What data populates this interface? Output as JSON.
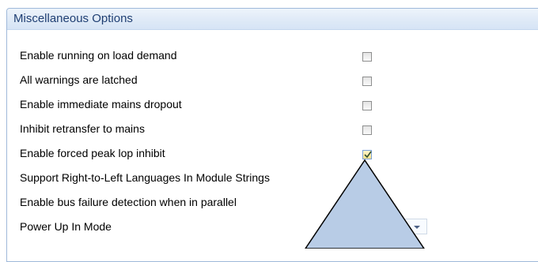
{
  "panel": {
    "title": "Miscellaneous Options"
  },
  "options": [
    {
      "label": "Enable running on load demand",
      "checked": false
    },
    {
      "label": "All warnings are latched",
      "checked": false
    },
    {
      "label": "Enable immediate mains dropout",
      "checked": false
    },
    {
      "label": "Inhibit retransfer to mains",
      "checked": false
    },
    {
      "label": "Enable forced peak lop inhibit",
      "checked": true
    },
    {
      "label": "Support Right-to-Left Languages In Module Strings"
    },
    {
      "label": "Enable bus failure detection when in parallel"
    },
    {
      "label": "Power Up In Mode"
    }
  ],
  "dropdown": {
    "icon": "chevron-down-icon"
  },
  "colors": {
    "header_text": "#1f3f73",
    "callout_fill": "#b8cce6"
  }
}
